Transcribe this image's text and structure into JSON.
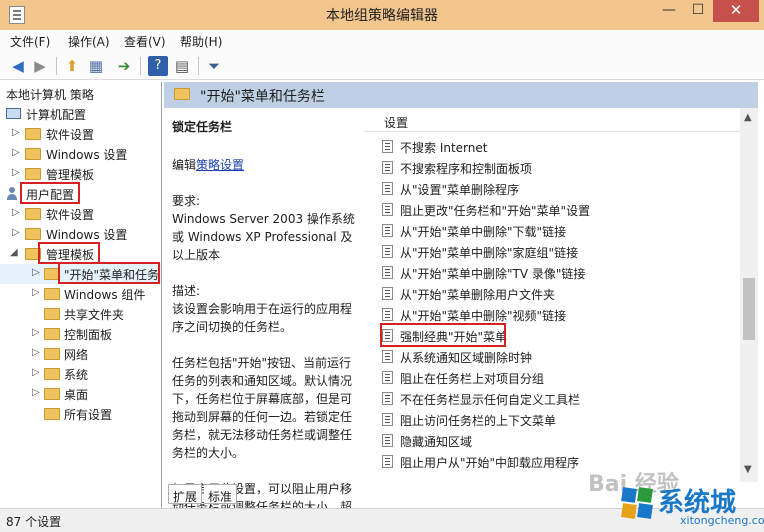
{
  "window": {
    "title": "本地组策略编辑器",
    "min_glyph": "—",
    "max_glyph": "☐",
    "close_glyph": "✕"
  },
  "menu": [
    "文件(F)",
    "操作(A)",
    "查看(V)",
    "帮助(H)"
  ],
  "tree": {
    "root": "本地计算机 策略",
    "computer_config": "计算机配置",
    "cc_children": [
      "软件设置",
      "Windows 设置",
      "管理模板"
    ],
    "user_config": "用户配置",
    "uc_children": [
      "软件设置",
      "Windows 设置",
      "管理模板"
    ],
    "admin_children": [
      "\"开始\"菜单和任务",
      "Windows 组件",
      "共享文件夹",
      "控制面板",
      "网络",
      "系统",
      "桌面",
      "所有设置"
    ]
  },
  "right": {
    "header_title": "\"开始\"菜单和任务栏",
    "column_header": "设置"
  },
  "description": {
    "setting_name": "锁定任务栏",
    "edit_prefix": "编辑",
    "edit_link": "策略设置",
    "requirements": "要求:\nWindows Server 2003 操作系统或 Windows XP Professional 及以上版本",
    "desc_1": "描述:\n该设置会影响用于在运行的应用程序之间切换的任务栏。",
    "desc_2": "任务栏包括\"开始\"按钮、当前运行任务的列表和通知区域。默认情况下，任务栏位于屏幕底部，但是可拖动到屏幕的任何一边。若锁定任务栏，就无法移动任务栏或调整任务栏的大小。",
    "desc_3": "如果启用此设置，可以阻止用户移动任务栏或调整任务栏的大小。超"
  },
  "settings": [
    "不搜索 Internet",
    "不搜索程序和控制面板项",
    "从\"设置\"菜单删除程序",
    "阻止更改\"任务栏和\"开始\"菜单\"设置",
    "从\"开始\"菜单中删除\"下载\"链接",
    "从\"开始\"菜单中删除\"家庭组\"链接",
    "从\"开始\"菜单中删除\"TV 录像\"链接",
    "从\"开始\"菜单删除用户文件夹",
    "从\"开始\"菜单中删除\"视频\"链接",
    "强制经典\"开始\"菜单",
    "从系统通知区域删除时钟",
    "阻止在任务栏上对项目分组",
    "不在任务栏显示任何自定义工具栏",
    "阻止访问任务栏的上下文菜单",
    "隐藏通知区域",
    "阻止用户从\"开始\"中卸载应用程序"
  ],
  "tabs": [
    "扩展",
    "标准"
  ],
  "status": "87 个设置",
  "watermark": {
    "brand": "系统城",
    "site": "xitongcheng.com",
    "baidu": "Bai 经验"
  },
  "colors": {
    "titlebar": "#f3c68d",
    "close_button": "#c7504a",
    "header_bar": "#bfd0e5",
    "highlight": "#d42222",
    "link": "#1a3fb0"
  }
}
